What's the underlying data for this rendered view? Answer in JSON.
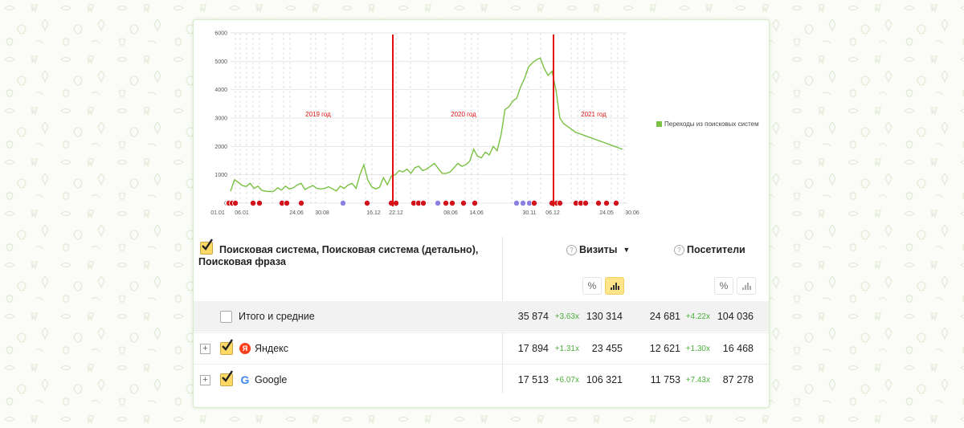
{
  "colors": {
    "accent": "#7ac143",
    "marker_red": "#d3131c",
    "marker_purple": "#8b7fe0",
    "divider_red": "#e01010",
    "growth_green": "#4caf3a",
    "active_toggle": "#ffe48a"
  },
  "chart_data": {
    "type": "line",
    "y_ticks": [
      "6000",
      "5000",
      "4000",
      "3000",
      "2000",
      "1000",
      "0"
    ],
    "ylim": [
      0,
      6000
    ],
    "x_ticks": [
      "01.01",
      "06.01",
      "24.06",
      "30.08",
      "16.12",
      "22.12",
      "08.06",
      "14.06",
      "30.11",
      "06.12",
      "24.05",
      "30.06"
    ],
    "series": [
      {
        "name": "Переходы из поисковых систем",
        "color": "#7ac143",
        "x": [
          0,
          1,
          2,
          3,
          4,
          5,
          6,
          7,
          8,
          9,
          10,
          11,
          12,
          13,
          14,
          15,
          16,
          17,
          18,
          19,
          20,
          21,
          22,
          23,
          24,
          25,
          26,
          27,
          28,
          29,
          30,
          31,
          32,
          33,
          34,
          35,
          36,
          37,
          38,
          39,
          40,
          41,
          42,
          43,
          44,
          45,
          46,
          47,
          48,
          49,
          50,
          51,
          52,
          53,
          54,
          55,
          56,
          57,
          58,
          59,
          60,
          61,
          62,
          63,
          64,
          65,
          66,
          67,
          68,
          69,
          70,
          71,
          72,
          73,
          74,
          75,
          76,
          77,
          78,
          79,
          80,
          81,
          82,
          83,
          84,
          85,
          86,
          87,
          88,
          89,
          90,
          91,
          92,
          93,
          94,
          95,
          96,
          97,
          98,
          99,
          100
        ],
        "values": [
          420,
          820,
          730,
          620,
          590,
          700,
          520,
          600,
          450,
          420,
          410,
          420,
          540,
          460,
          600,
          500,
          540,
          640,
          700,
          480,
          560,
          620,
          520,
          500,
          520,
          580,
          500,
          430,
          600,
          520,
          640,
          700,
          520,
          1000,
          1350,
          820,
          580,
          500,
          560,
          900,
          650,
          950,
          1000,
          1150,
          1100,
          1200,
          1050,
          1250,
          1300,
          1150,
          1200,
          1300,
          1400,
          1220,
          1050,
          1050,
          1100,
          1250,
          1400,
          1300,
          1350,
          1480,
          1900,
          1650,
          1600,
          1800,
          1700,
          2000,
          1850,
          2400,
          3300,
          3400,
          3600,
          3700,
          4100,
          4400,
          4800,
          4950,
          5050,
          5120,
          4750,
          4500,
          4650,
          4000,
          3000,
          2800,
          2700,
          2600,
          2500,
          2450,
          2400,
          2350,
          2300,
          2250,
          2200,
          2150,
          2100,
          2050,
          2000,
          1950,
          1900
        ]
      }
    ],
    "annotations": [
      "2019 год",
      "2020 год",
      "2021 год"
    ],
    "legend": "right"
  },
  "table": {
    "dimension_header": "Поисковая система, Поисковая система (детально), Поисковая фраза",
    "metrics": [
      {
        "label": "Визиты",
        "sort": "▼"
      },
      {
        "label": "Посетители"
      }
    ],
    "help_glyph": "?",
    "percent_glyph": "%",
    "total": {
      "label": "Итого и средние",
      "visits": "35 874",
      "visits_growth": "+3.63x",
      "visits_prev": "130 314",
      "users": "24 681",
      "users_growth": "+4.22x",
      "users_prev": "104 036"
    },
    "rows": [
      {
        "icon": "yandex-icon",
        "icon_text": "Я",
        "label": "Яндекс",
        "visits": "17 894",
        "visits_growth": "+1.31x",
        "visits_prev": "23 455",
        "users": "12 621",
        "users_growth": "+1.30x",
        "users_prev": "16 468"
      },
      {
        "icon": "google-icon",
        "icon_text": "G",
        "label": "Google",
        "visits": "17 513",
        "visits_growth": "+6.07x",
        "visits_prev": "106 321",
        "users": "11 753",
        "users_growth": "+7.43x",
        "users_prev": "87 278"
      }
    ],
    "expand_glyph": "+"
  }
}
